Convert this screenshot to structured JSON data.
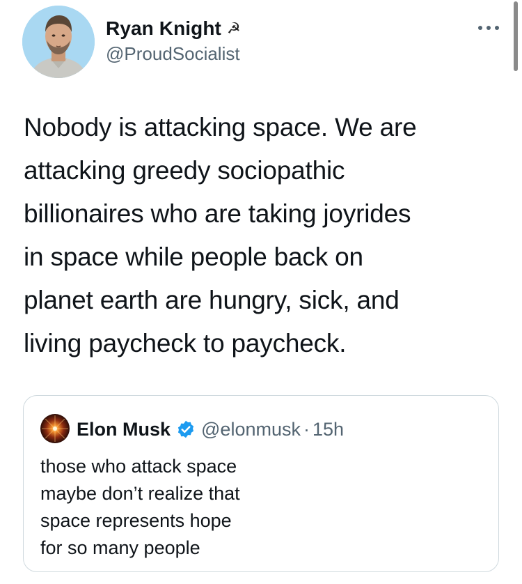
{
  "tweet": {
    "author_name": "Ryan Knight",
    "author_emoji": "☭",
    "author_handle": "@ProudSocialist",
    "more_icon": "more-horizontal-icon",
    "text": "Nobody is attacking space. We are\nattacking greedy sociopathic\nbillionaires who are taking joyrides\nin space while people back on\nplanet earth are hungry, sick, and\nliving paycheck to paycheck."
  },
  "quote": {
    "author_name": "Elon Musk",
    "verified_icon": "verified-badge-icon",
    "author_handle": "@elonmusk",
    "separator": "·",
    "time": "15h",
    "text": "those who attack space\nmaybe don’t realize that\nspace represents hope\nfor so many people"
  },
  "colors": {
    "text_primary": "#0f1419",
    "text_secondary": "#536471",
    "verified_blue": "#1d9bf0",
    "border": "#cfd9de"
  }
}
